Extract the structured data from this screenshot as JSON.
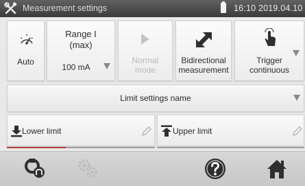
{
  "title_bar": {
    "title": "Measurement settings",
    "datetime": "16:10 2019.04.10",
    "icons": [
      "tools-icon",
      "battery-icon"
    ]
  },
  "params": {
    "auto": {
      "label": "Auto",
      "icon": "gauge-icon"
    },
    "range": {
      "title": "Range I (max)",
      "title_line1": "Range I",
      "title_line2": "(max)",
      "value": "100 mA"
    },
    "mode": {
      "line1": "Normal",
      "line2": "mode",
      "disabled": true,
      "icon": "play-icon"
    },
    "direction": {
      "line1": "Bidirectional",
      "line2": "measurement",
      "icon": "bidirectional-arrows-icon"
    },
    "trigger": {
      "line1": "Trigger",
      "line2": "continuous",
      "icon": "touch-finger-icon"
    }
  },
  "limits": {
    "name_label": "Limit settings name",
    "lower_label": "Lower limit",
    "upper_label": "Upper limit"
  },
  "bottom_bar": {
    "icons": [
      "probe-settings-icon",
      "gears-icon",
      "help-icon",
      "home-icon"
    ],
    "gears_disabled": true
  },
  "colors": {
    "titlebar": "#4a4a4a",
    "accent_red": "#b23a3a",
    "icon_dark": "#3a3a3a",
    "disabled_gray": "#c4c4c4"
  }
}
